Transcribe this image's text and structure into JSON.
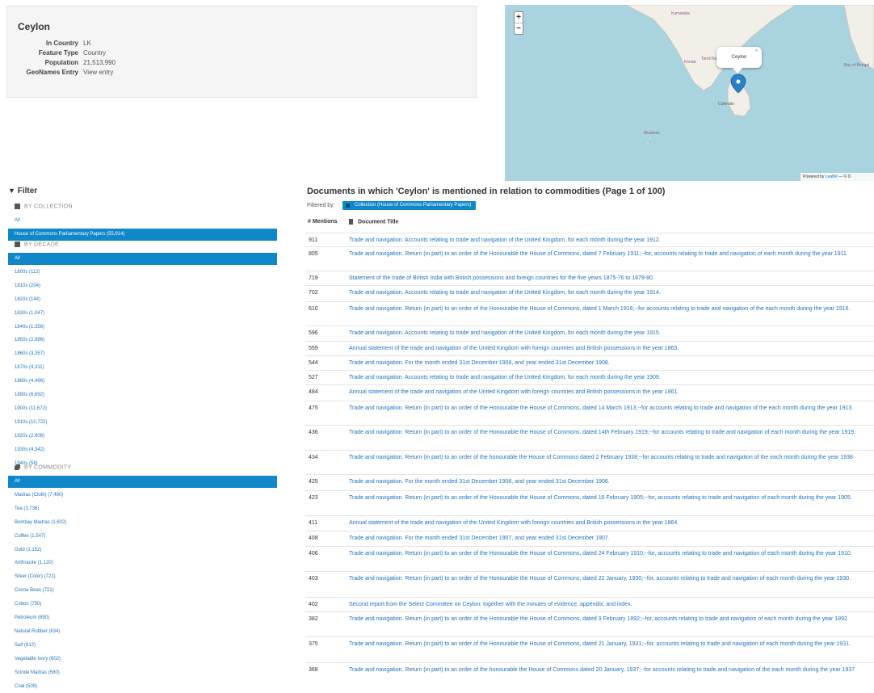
{
  "place": {
    "name": "Ceylon",
    "fields": [
      {
        "label": "In Country",
        "value": "LK",
        "link": false
      },
      {
        "label": "Feature Type",
        "value": "Country",
        "link": false
      },
      {
        "label": "Population",
        "value": "21,513,990",
        "link": false
      },
      {
        "label": "GeoNames Entry",
        "value": "View entry",
        "link": true
      }
    ]
  },
  "map": {
    "zoom_in": "+",
    "zoom_out": "−",
    "popup_label": "Ceylon",
    "popup_close": "×",
    "labels": {
      "colombo": "Colombo",
      "maldives": "Maldives",
      "karnataka": "Karnataka",
      "tamil": "Tamil Nadu",
      "kerala": "Kerala",
      "bay": "Bay of Bengal"
    },
    "attribution_prefix": "Powered by",
    "attribution_link": "Leaflet",
    "attribution_suffix": "— © O",
    "colors": {
      "water": "#a9d3de",
      "land": "#f1efe8",
      "marker": "#2a81cb"
    }
  },
  "filter": {
    "heading": "Filter",
    "collection": {
      "header": "BY COLLECTION",
      "items": [
        "All",
        "House of Commons Parliamentary Papers (55,914)"
      ],
      "active": 1
    },
    "decade": {
      "header": "BY DECADE",
      "items": [
        "All",
        "1800s (112)",
        "1810s (204)",
        "1820s (144)",
        "1830s (1,047)",
        "1840s (1,356)",
        "1850s (2,986)",
        "1860s (3,357)",
        "1870s (4,311)",
        "1880s (4,496)",
        "1890s (6,692)",
        "1900s (11,672)",
        "1910s (10,722)",
        "1920s (2,608)",
        "1930s (4,342)",
        "1940s (58)"
      ],
      "active": 0
    },
    "commodity": {
      "header": "BY COMMODITY",
      "items": [
        "All",
        "Madras (Cloth) (7,490)",
        "Tea (3,736)",
        "Bombay Madras (1,602)",
        "Coffee (1,547)",
        "Gold (1,152)",
        "Anthracite (1,120)",
        "Silver (Color) (721)",
        "Cocoa Bean (721)",
        "Cotton (730)",
        "Petroleum (690)",
        "Natural Rubber (634)",
        "Salt (612)",
        "Vegetable Ivory (602)",
        "Scinde Madras (580)",
        "Coal (509)"
      ],
      "active": 0
    }
  },
  "results": {
    "title": "Documents in which 'Ceylon' is mentioned in relation to commodities (Page 1 of 100)",
    "filtered_by_label": "Filtered by:",
    "filter_tag": "Collection (House of Commons Parliamentary Papers)",
    "col_mentions": "# Mentions",
    "col_title": "Document Title",
    "rows": [
      {
        "count": "911",
        "title": "Trade and navigation. Accounts relating to trade and navigation of the United Kingdom, for each month during the year 1912."
      },
      {
        "count": "805",
        "title": "Trade and navigation. Return (in part) to an order of the Honourable the House of Commons, dated 7 February 1911;--for, accounts relating to trade and navigation of each month during the year 1911."
      },
      {
        "count": "719",
        "title": "Statement of the trade of British India with British possessions and foreign countries for the five years 1875-76 to 1879-80."
      },
      {
        "count": "702",
        "title": "Trade and navigation. Accounts relating to trade and navigation of the United Kingdom, for each month during the year 1914."
      },
      {
        "count": "610",
        "title": "Trade and navigation. Return (in part) to an order of the Honourable the House of Commons, dated 1 March 1916;--for accounts relating to trade and navigation of the each month during the year 1916."
      },
      {
        "count": "596",
        "title": "Trade and navigation. Accounts relating to trade and navigation of the United Kingdom, for each month during the year 1915."
      },
      {
        "count": "559",
        "title": "Annual statement of the trade and navigation of the United Kingdom with foreign countries and British possessions in the year 1863."
      },
      {
        "count": "544",
        "title": "Trade and navigation. For the month ended 31st December 1908, and year ended 31st December 1908."
      },
      {
        "count": "527",
        "title": "Trade and navigation. Accounts relating to trade and navigation of the United Kingdom, for each month during the year 1909."
      },
      {
        "count": "484",
        "title": "Annual statement of the trade and navigation of the United Kingdom with foreign countries and British possessions in the year 1861."
      },
      {
        "count": "475",
        "title": "Trade and navigation. Return (in part) to an order of the Honourable the House of Commons, dated 14 March 1913;--for accounts relating to trade and navigation of the each month during the year 1913."
      },
      {
        "count": "436",
        "title": "Trade and navigation. Return (in part) to an order of the Honourable the House of Commons, dated 14th February 1919;--for accounts relating to trade and navigation of each month during the year 1919."
      },
      {
        "count": "434",
        "title": "Trade and navigation. Return (in part) to an order of the honourable the House of Commons dated 2 February 1938;--for accounts relating to trade and navigation of the each month during the year 1938"
      },
      {
        "count": "425",
        "title": "Trade and navigation. For the month ended 31st December 1906, and year ended 31st December 1906."
      },
      {
        "count": "423",
        "title": "Trade and navigation. Return (in part) to an order of the Honourable the House of Commons, dated 16 February 1905;--for, accounts relating to trade and navigation of each month during the year 1905."
      },
      {
        "count": "411",
        "title": "Annual statement of the trade and navigation of the United Kingdom with foreign countries and British possessions in the year 1864."
      },
      {
        "count": "408",
        "title": "Trade and navigation. For the month ended 31st December 1907, and year ended 31st December 1907."
      },
      {
        "count": "406",
        "title": "Trade and navigation. Return (in part) to an order of the Honourable the House of Commons, dated 24 February 1910;--for, accounts relating to trade and navigation of each month during the year 1910."
      },
      {
        "count": "403",
        "title": "Trade and navigation. Return (in part) to an order of the Honourable the House of Commons, dated 22 January, 1930;--for, accounts relating to trade and navigation of each month during the year 1930."
      },
      {
        "count": "402",
        "title": "Second report from the Select Committee on Ceylon; together with the minutes of evidence, appendix, and index."
      },
      {
        "count": "382",
        "title": "Trade and navigation. Return (in part) to an order of the Honourable the House of Commons, dated 9 February 1892;--for, accounts relating to trade and navigation of each month during the year 1892."
      },
      {
        "count": "375",
        "title": "Trade and navigation. Return (in part) to an order of the Honourable the House of Commons, dated 21 January, 1931;--for, accounts relating to trade and navigation of each month during the year 1931."
      },
      {
        "count": "368",
        "title": "Trade and navigation. Return (in part) to an order of the honourable the House of Commons dated 20 January, 1937;--for accounts relating to trade and navigation of the each month during the year 1937"
      }
    ]
  }
}
